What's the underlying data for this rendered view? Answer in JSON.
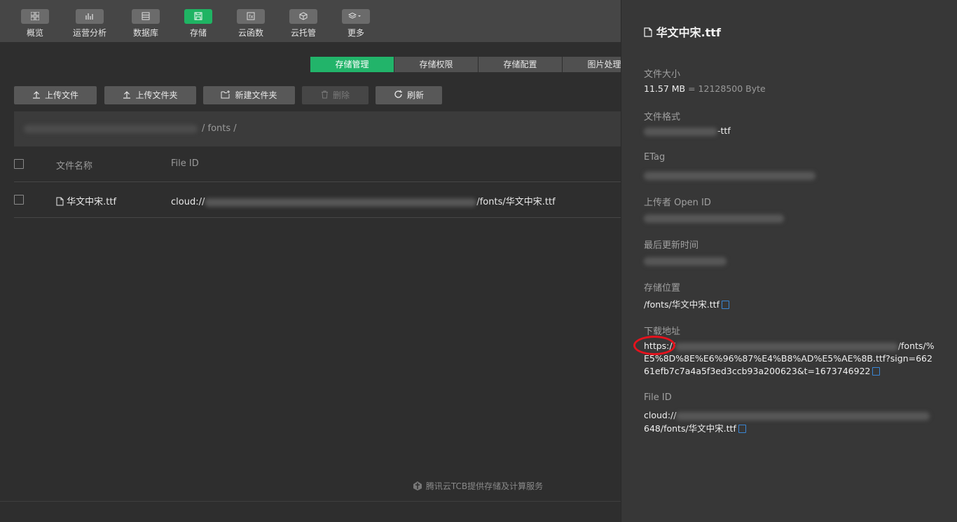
{
  "nav": {
    "items": [
      {
        "label": "概览",
        "icon": "grid-icon"
      },
      {
        "label": "运营分析",
        "icon": "bar-chart-icon"
      },
      {
        "label": "数据库",
        "icon": "database-icon"
      },
      {
        "label": "存储",
        "icon": "save-icon",
        "active": true
      },
      {
        "label": "云函数",
        "icon": "function-icon"
      },
      {
        "label": "云托管",
        "icon": "cube-icon"
      },
      {
        "label": "更多",
        "icon": "layers-icon"
      }
    ]
  },
  "tabs": [
    {
      "label": "存储管理",
      "active": true
    },
    {
      "label": "存储权限"
    },
    {
      "label": "存储配置"
    },
    {
      "label": "图片处理"
    }
  ],
  "toolbar": {
    "upload_file": "上传文件",
    "upload_folder": "上传文件夹",
    "new_folder": "新建文件夹",
    "delete": "删除",
    "refresh": "刷新"
  },
  "path": {
    "suffix": "/ fonts /"
  },
  "table": {
    "headers": {
      "name": "文件名称",
      "file_id": "File ID"
    },
    "rows": [
      {
        "name": "华文中宋.ttf",
        "file_id_prefix": "cloud://",
        "file_id_suffix": "/fonts/华文中宋.ttf"
      }
    ]
  },
  "footer": {
    "text": "腾讯云TCB提供存储及计算服务"
  },
  "detail": {
    "title": "华文中宋.ttf",
    "size_label": "文件大小",
    "size_value": "11.57 MB",
    "size_bytes": "= 12128500 Byte",
    "format_label": "文件格式",
    "format_value": "-ttf",
    "etag_label": "ETag",
    "uploader_label": "上传者 Open ID",
    "updated_label": "最后更新时间",
    "location_label": "存储位置",
    "location_value": "/fonts/华文中宋.ttf",
    "download_label": "下载地址",
    "download_prefix": "https://",
    "download_path_start": "/fonts/%",
    "download_rest": "E5%8D%8E%E6%96%87%E4%B8%AD%E5%AE%8B.ttf?sign=66261efb7c7a4a5f3ed3ccb93a200623&t=1673746922",
    "fileid_label": "File ID",
    "fileid_prefix": "cloud://",
    "fileid_line2": "648/fonts/华文中宋.ttf"
  },
  "colors": {
    "accent": "#1fb463",
    "highlight_ring": "#e5121d",
    "copy_icon": "#3a86d4"
  }
}
